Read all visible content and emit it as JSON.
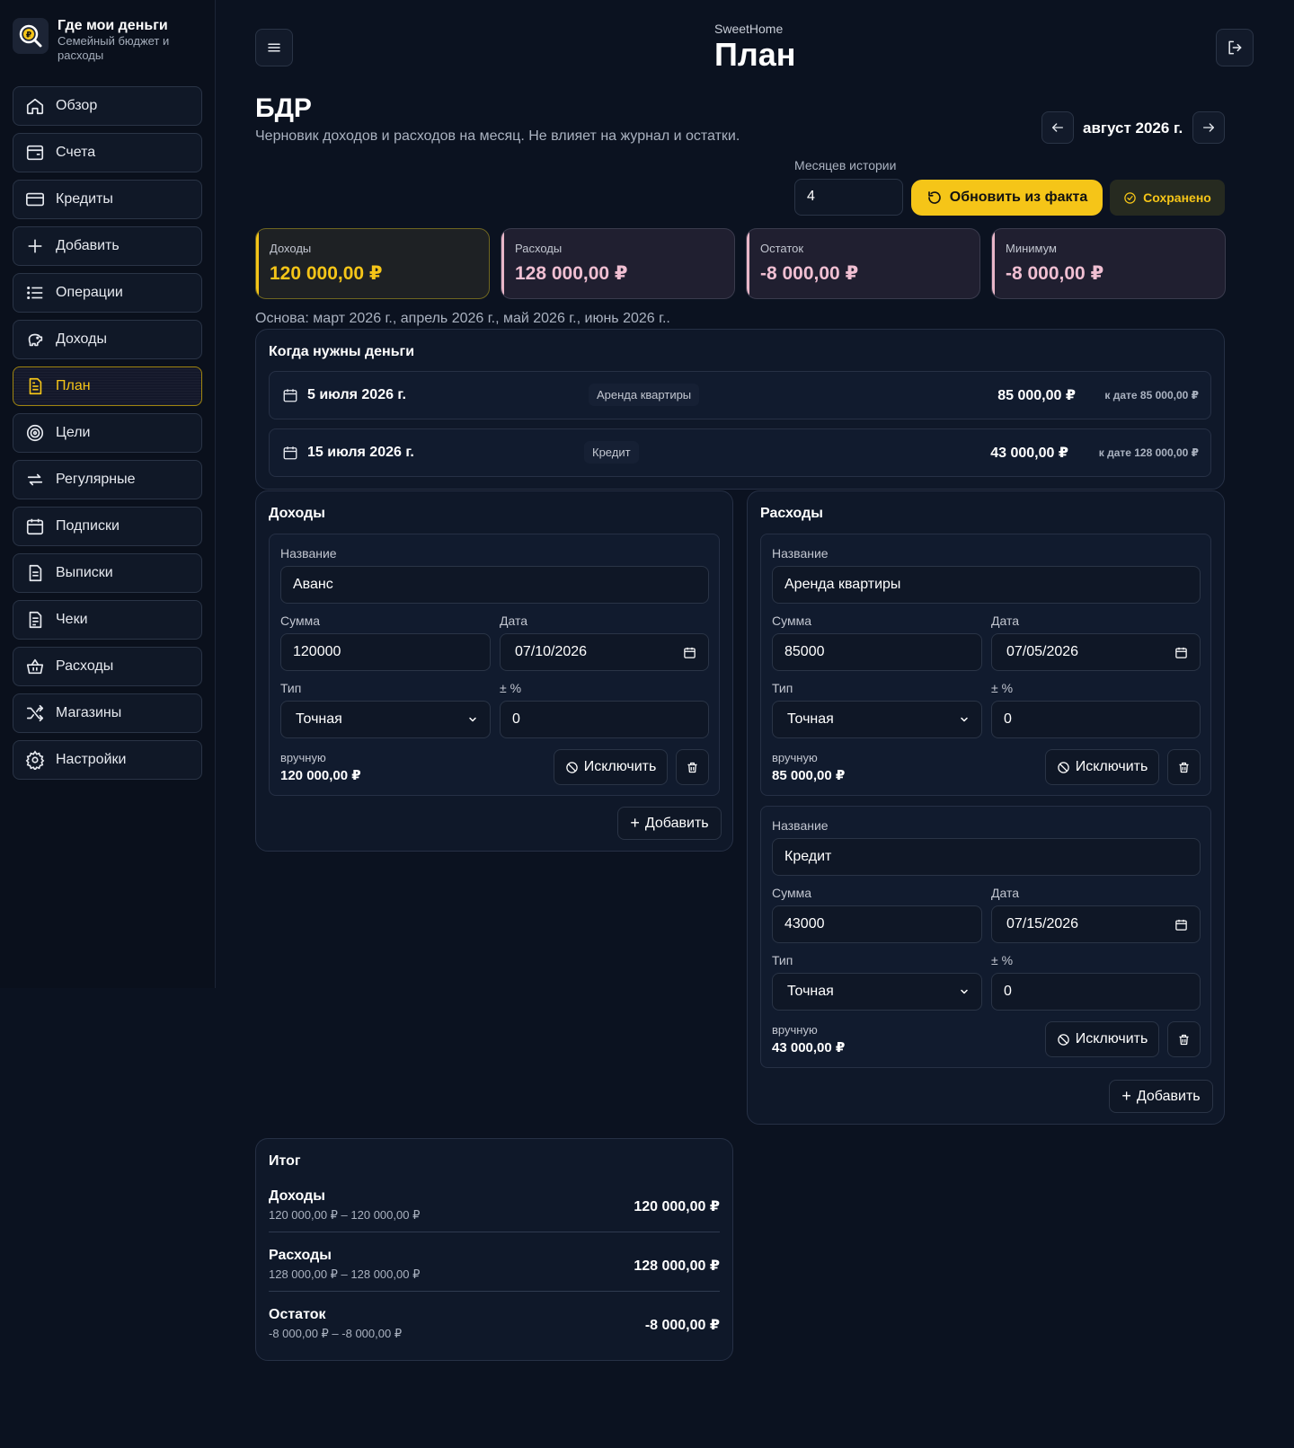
{
  "app": {
    "title": "Где мои деньги",
    "subtitle": "Семейный бюджет и расходы"
  },
  "sidebar": {
    "items": [
      {
        "label": "Обзор",
        "icon": "home-icon"
      },
      {
        "label": "Счета",
        "icon": "wallet-icon"
      },
      {
        "label": "Кредиты",
        "icon": "credit-card-icon"
      },
      {
        "label": "Добавить",
        "icon": "plus-icon"
      },
      {
        "label": "Операции",
        "icon": "list-icon"
      },
      {
        "label": "Доходы",
        "icon": "piggy-bank-icon"
      },
      {
        "label": "План",
        "icon": "document-icon",
        "active": true
      },
      {
        "label": "Цели",
        "icon": "target-icon"
      },
      {
        "label": "Регулярные",
        "icon": "repeat-icon"
      },
      {
        "label": "Подписки",
        "icon": "calendar-icon"
      },
      {
        "label": "Выписки",
        "icon": "statement-icon"
      },
      {
        "label": "Чеки",
        "icon": "receipt-icon"
      },
      {
        "label": "Расходы",
        "icon": "basket-icon"
      },
      {
        "label": "Магазины",
        "icon": "shuffle-icon"
      },
      {
        "label": "Настройки",
        "icon": "gear-icon"
      }
    ]
  },
  "header": {
    "household": "SweetHome",
    "title": "План"
  },
  "section": {
    "title": "БДР",
    "description": "Черновик доходов и расходов на месяц. Не влияет на журнал и остатки."
  },
  "period": {
    "label": "август 2026 г."
  },
  "history": {
    "label": "Месяцев истории",
    "value": "4",
    "refresh_label": "Обновить из факта",
    "saved_label": "Сохранено"
  },
  "stats": [
    {
      "label": "Доходы",
      "value": "120 000,00 ₽"
    },
    {
      "label": "Расходы",
      "value": "128 000,00 ₽"
    },
    {
      "label": "Остаток",
      "value": "-8 000,00 ₽"
    },
    {
      "label": "Минимум",
      "value": "-8 000,00 ₽"
    }
  ],
  "basis": "Основа: март 2026 г., апрель 2026 г., май 2026 г., июнь 2026 г..",
  "needs": {
    "title": "Когда нужны деньги",
    "rows": [
      {
        "date": "5 июля 2026 г.",
        "tag": "Аренда квартиры",
        "amount": "85 000,00 ₽",
        "cumulative": "к дате 85 000,00 ₽"
      },
      {
        "date": "15 июля 2026 г.",
        "tag": "Кредит",
        "amount": "43 000,00 ₽",
        "cumulative": "к дате 128 000,00 ₽"
      }
    ]
  },
  "labels": {
    "name": "Название",
    "sum": "Сумма",
    "date": "Дата",
    "type": "Тип",
    "pct": "± %",
    "manual": "вручную",
    "exclude": "Исключить",
    "add": "Добавить"
  },
  "income": {
    "title": "Доходы",
    "items": [
      {
        "name": "Аванс",
        "sum": "120000",
        "date": "07/10/2026",
        "type": "Точная",
        "pct": "0",
        "manual_total": "120 000,00 ₽"
      }
    ]
  },
  "expenses": {
    "title": "Расходы",
    "items": [
      {
        "name": "Аренда квартиры",
        "sum": "85000",
        "date": "07/05/2026",
        "type": "Точная",
        "pct": "0",
        "manual_total": "85 000,00 ₽"
      },
      {
        "name": "Кредит",
        "sum": "43000",
        "date": "07/15/2026",
        "type": "Точная",
        "pct": "0",
        "manual_total": "43 000,00 ₽"
      }
    ]
  },
  "totals": {
    "title": "Итог",
    "rows": [
      {
        "name": "Доходы",
        "range": "120 000,00 ₽ – 120 000,00 ₽",
        "value": "120 000,00 ₽"
      },
      {
        "name": "Расходы",
        "range": "128 000,00 ₽ – 128 000,00 ₽",
        "value": "128 000,00 ₽"
      },
      {
        "name": "Остаток",
        "range": "-8 000,00 ₽ – -8 000,00 ₽",
        "value": "-8 000,00 ₽"
      }
    ]
  },
  "colors": {
    "accent": "#f5c518",
    "background": "#0b1220",
    "expense_value": "#f0bfd2"
  }
}
